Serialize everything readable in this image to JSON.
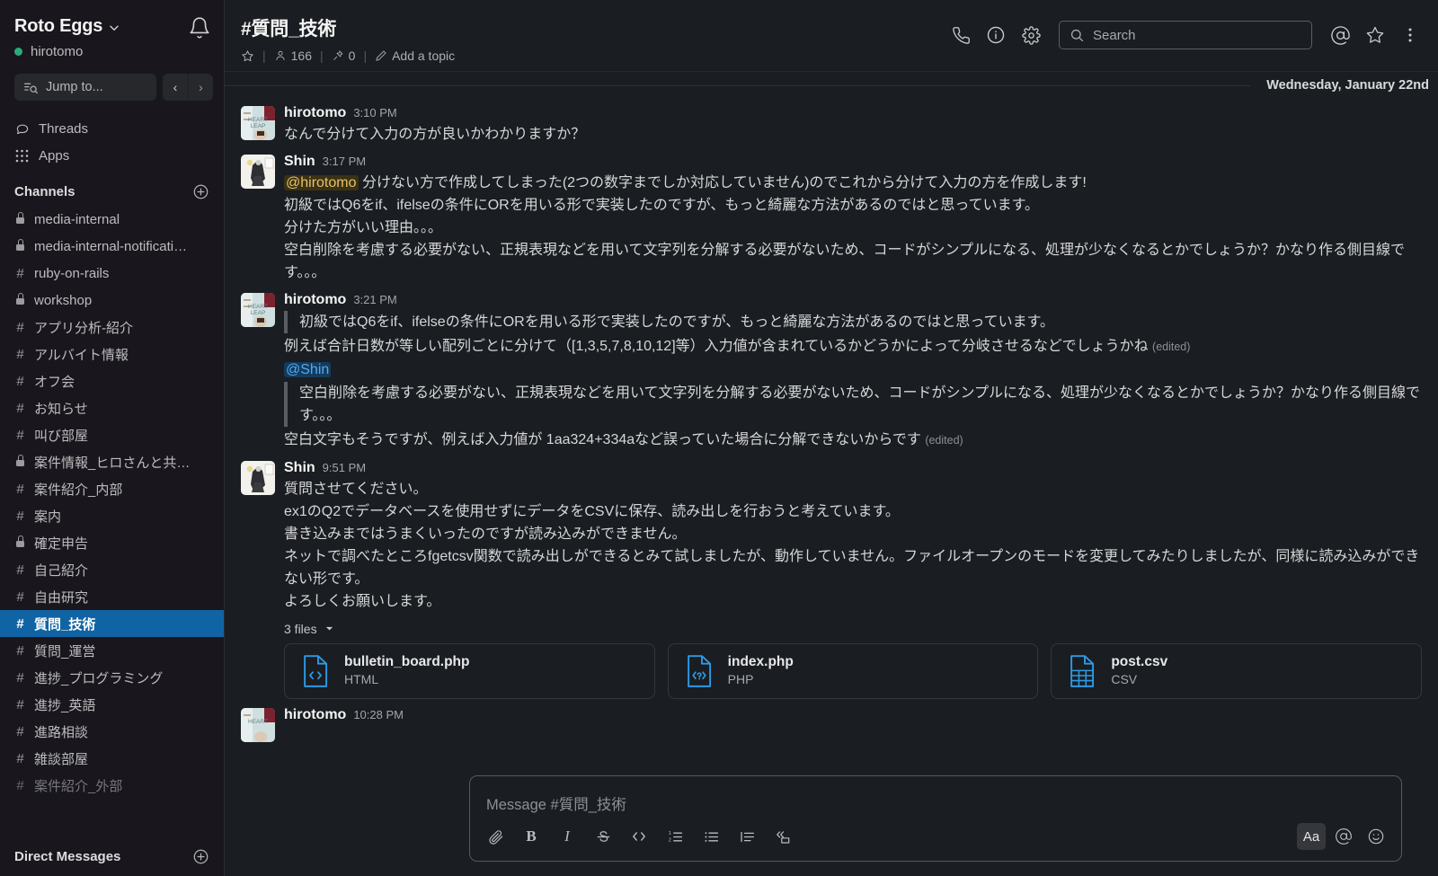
{
  "workspace": {
    "name": "Roto Eggs",
    "caret": "chevron-down",
    "user": "hirotomo",
    "jump_placeholder": "Jump to...",
    "nav_back": "‹",
    "nav_forward": "›"
  },
  "sidebar": {
    "nav": [
      {
        "label": "Threads",
        "icon": "threads-icon"
      },
      {
        "label": "Apps",
        "icon": "apps-icon"
      }
    ],
    "channels_header": "Channels",
    "dm_header": "Direct Messages",
    "channels": [
      {
        "name": "media-internal",
        "private": true,
        "active": false,
        "muted": false
      },
      {
        "name": "media-internal-notificati…",
        "private": true,
        "active": false,
        "muted": false
      },
      {
        "name": "ruby-on-rails",
        "private": false,
        "active": false,
        "muted": false
      },
      {
        "name": "workshop",
        "private": true,
        "active": false,
        "muted": false
      },
      {
        "name": "アプリ分析-紹介",
        "private": false,
        "active": false,
        "muted": false
      },
      {
        "name": "アルバイト情報",
        "private": false,
        "active": false,
        "muted": false
      },
      {
        "name": "オフ会",
        "private": false,
        "active": false,
        "muted": false
      },
      {
        "name": "お知らせ",
        "private": false,
        "active": false,
        "muted": false
      },
      {
        "name": "叫び部屋",
        "private": false,
        "active": false,
        "muted": false
      },
      {
        "name": "案件情報_ヒロさんと共…",
        "private": true,
        "active": false,
        "muted": false
      },
      {
        "name": "案件紹介_内部",
        "private": false,
        "active": false,
        "muted": false
      },
      {
        "name": "案内",
        "private": false,
        "active": false,
        "muted": false
      },
      {
        "name": "確定申告",
        "private": true,
        "active": false,
        "muted": false
      },
      {
        "name": "自己紹介",
        "private": false,
        "active": false,
        "muted": false
      },
      {
        "name": "自由研究",
        "private": false,
        "active": false,
        "muted": false
      },
      {
        "name": "質問_技術",
        "private": false,
        "active": true,
        "muted": false
      },
      {
        "name": "質問_運営",
        "private": false,
        "active": false,
        "muted": false
      },
      {
        "name": "進捗_プログラミング",
        "private": false,
        "active": false,
        "muted": false
      },
      {
        "name": "進捗_英語",
        "private": false,
        "active": false,
        "muted": false
      },
      {
        "name": "進路相談",
        "private": false,
        "active": false,
        "muted": false
      },
      {
        "name": "雑談部屋",
        "private": false,
        "active": false,
        "muted": false
      },
      {
        "name": "案件紹介_外部",
        "private": false,
        "active": false,
        "muted": true
      }
    ]
  },
  "channel_header": {
    "title": "#質問_技術",
    "star_icon": "star-icon",
    "members_count": "166",
    "pins_count": "0",
    "topic_label": "Add a topic",
    "call_icon": "phone-icon",
    "info_icon": "info-icon",
    "settings_icon": "gear-icon",
    "search_placeholder": "Search",
    "mentions_icon": "at-icon",
    "starred_icon": "star-icon",
    "more_icon": "more-vertical-icon"
  },
  "messages": {
    "date_divider": "Wednesday, January 22nd",
    "items": [
      {
        "author": "hirotomo",
        "time": "3:10 PM",
        "avatar": "hirotomo-avatar",
        "lines": [
          {
            "text": "なんで分けて入力の方が良いかわかりますか？"
          }
        ]
      },
      {
        "author": "Shin",
        "time": "3:17 PM",
        "avatar": "shin-avatar",
        "lines": [
          {
            "mention": "@hirotomo",
            "text": " 分けない方で作成してしまった(2つの数字までしか対応していません)のでこれから分けて入力の方を作成します!"
          },
          {
            "text": "初級ではQ6をif、ifelseの条件にORを用いる形で実装したのですが、もっと綺麗な方法があるのではと思っています。"
          },
          {
            "text": "分けた方がいい理由。。。"
          },
          {
            "text": "空白削除を考慮する必要がない、正規表現などを用いて文字列を分解する必要がないため、コードがシンプルになる、処理が少なくなるとかでしょうか？かなり作る側目線です。。。"
          }
        ]
      },
      {
        "author": "hirotomo",
        "time": "3:21 PM",
        "avatar": "hirotomo-avatar",
        "quote1": "初級ではQ6をif、ifelseの条件にORを用いる形で実装したのですが、もっと綺麗な方法があるのではと思っています。",
        "line1": "例えば合計日数が等しい配列ごとに分けて（[1,3,5,7,8,10,12]等）入力値が含まれているかどうかによって分岐させるなどでしょうかね",
        "edited1": "(edited)",
        "mention2": "@Shin",
        "quote2": "空白削除を考慮する必要がない、正規表現などを用いて文字列を分解する必要がないため、コードがシンプルになる、処理が少なくなるとかでしょうか？かなり作る側目線です。。。",
        "line2": "空白文字もそうですが、例えば入力値が 1aa324+334aなど誤っていた場合に分解できないからです",
        "edited2": "(edited)"
      },
      {
        "author": "Shin",
        "time": "9:51 PM",
        "avatar": "shin-avatar",
        "lines": [
          {
            "text": "質問させてください。"
          },
          {
            "text": "ex1のQ2でデータベースを使用せずにデータをCSVに保存、読み出しを行おうと考えています。"
          },
          {
            "text": "書き込みまではうまくいったのですが読み込みができません。"
          },
          {
            "text": "ネットで調べたところfgetcsv関数で読み出しができるとみて試しましたが、動作していません。ファイルオープンのモードを変更してみたりしましたが、同様に読み込みができない形です。"
          },
          {
            "text": "よろしくお願いします。"
          }
        ],
        "files_label": "3 files",
        "files": [
          {
            "name": "bulletin_board.php",
            "type": "HTML",
            "icon": "code-file-icon"
          },
          {
            "name": "index.php",
            "type": "PHP",
            "icon": "php-file-icon"
          },
          {
            "name": "post.csv",
            "type": "CSV",
            "icon": "csv-file-icon"
          }
        ]
      },
      {
        "author": "hirotomo",
        "time": "10:28 PM",
        "avatar": "hirotomo-avatar",
        "lines": []
      }
    ]
  },
  "composer": {
    "placeholder": "Message #質問_技術",
    "tools_left": [
      {
        "name": "attach-icon",
        "glyph": "attach"
      },
      {
        "name": "bold-icon",
        "glyph": "B"
      },
      {
        "name": "italic-icon",
        "glyph": "I"
      },
      {
        "name": "strikethrough-icon",
        "glyph": "S"
      },
      {
        "name": "code-icon",
        "glyph": "</>"
      },
      {
        "name": "ordered-list-icon",
        "glyph": "ol"
      },
      {
        "name": "bulleted-list-icon",
        "glyph": "ul"
      },
      {
        "name": "blockquote-icon",
        "glyph": "bq"
      },
      {
        "name": "code-block-icon",
        "glyph": "cb"
      }
    ],
    "tools_right": [
      {
        "name": "formatting-icon",
        "glyph": "Aa",
        "active": true
      },
      {
        "name": "mention-icon",
        "glyph": "@",
        "active": false
      },
      {
        "name": "emoji-icon",
        "glyph": "smiley",
        "active": false
      }
    ]
  },
  "colors": {
    "sidebar_bg": "#19171d",
    "main_bg": "#1a1d21",
    "active_channel": "#1164a3",
    "accent_blue": "#36a3f7",
    "mention_yellow": "#e8c26a",
    "presence_green": "#2bac76"
  }
}
